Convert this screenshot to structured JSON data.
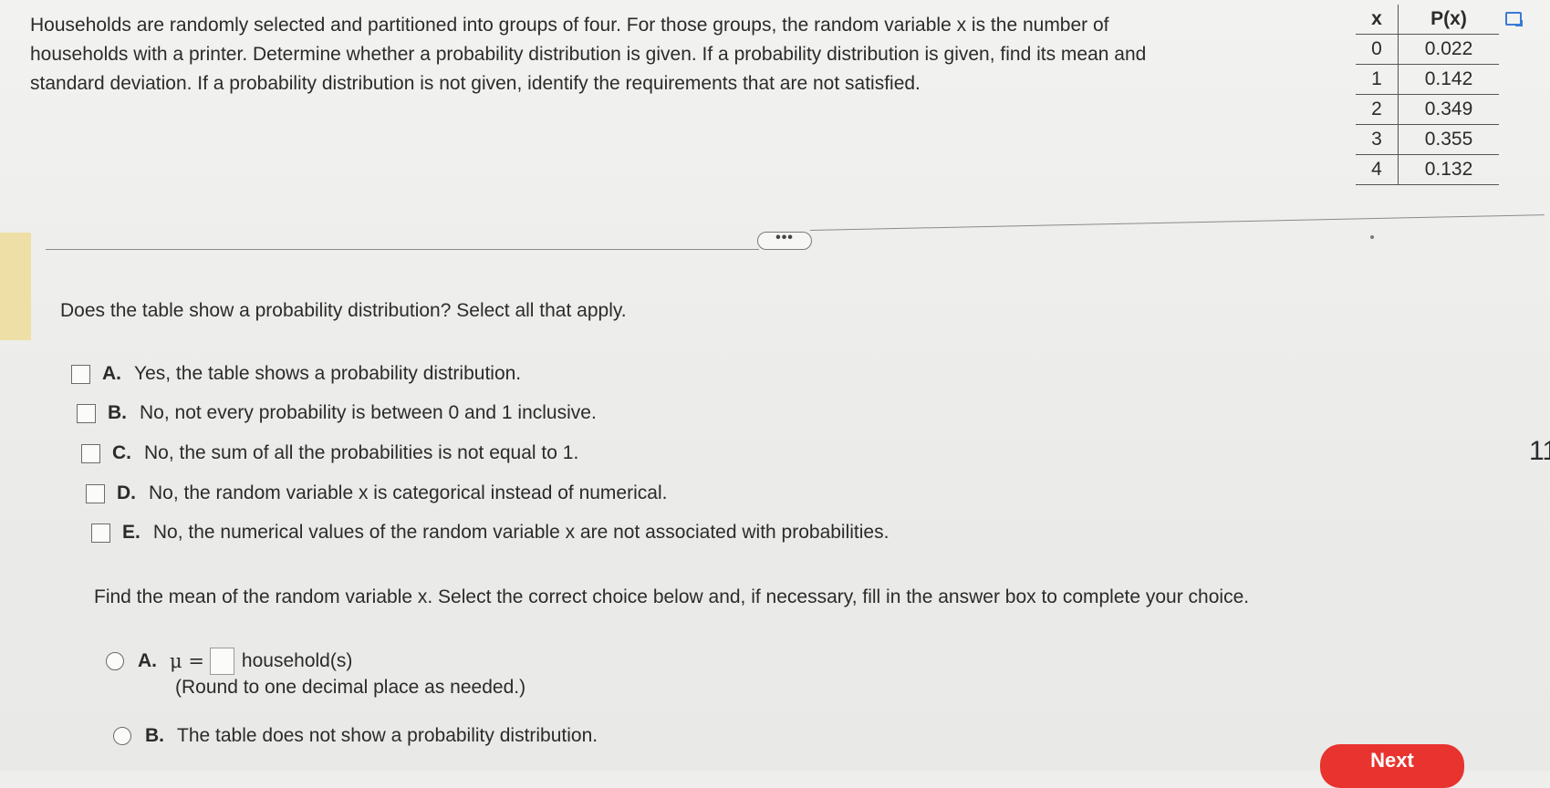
{
  "problem": {
    "lines": [
      "Households are randomly selected and partitioned into groups of four. For those groups, the random variable x is the number of",
      "households with a printer. Determine whether a probability distribution is given. If a probability distribution is given, find its mean and",
      "standard deviation. If a probability distribution is not given, identify the requirements that are not satisfied."
    ]
  },
  "table": {
    "headers": [
      "x",
      "P(x)"
    ],
    "rows": [
      [
        "0",
        "0.022"
      ],
      [
        "1",
        "0.142"
      ],
      [
        "2",
        "0.349"
      ],
      [
        "3",
        "0.355"
      ],
      [
        "4",
        "0.132"
      ]
    ]
  },
  "divider": {
    "more_label": "•••"
  },
  "question1": {
    "prompt": "Does the table show a probability distribution? Select all that apply.",
    "options": [
      {
        "letter": "A.",
        "text": "Yes, the table shows a probability distribution."
      },
      {
        "letter": "B.",
        "text": "No, not every probability is between 0 and 1 inclusive."
      },
      {
        "letter": "C.",
        "text": "No, the sum of all the probabilities is not equal to 1."
      },
      {
        "letter": "D.",
        "text": "No, the random variable x is categorical instead of numerical."
      },
      {
        "letter": "E.",
        "text": "No, the numerical values of the random variable x are not associated with probabilities."
      }
    ]
  },
  "question2": {
    "prompt": "Find the mean of the random variable x. Select the correct choice below and, if necessary, fill in the answer box to complete your choice.",
    "option_a": {
      "letter": "A.",
      "prefix": "μ =",
      "suffix": "household(s)",
      "hint": "(Round to one decimal place as needed.)"
    },
    "option_b": {
      "letter": "B.",
      "text": "The table does not show a probability distribution."
    }
  },
  "next_button": {
    "label": "Next"
  },
  "edge_fragment": "11",
  "colors": {
    "accent_red": "#e8332f",
    "icon_blue": "#3a7bd5",
    "left_accent": "#eedfa6"
  },
  "icons": {
    "table_corner": "copy-icon"
  }
}
